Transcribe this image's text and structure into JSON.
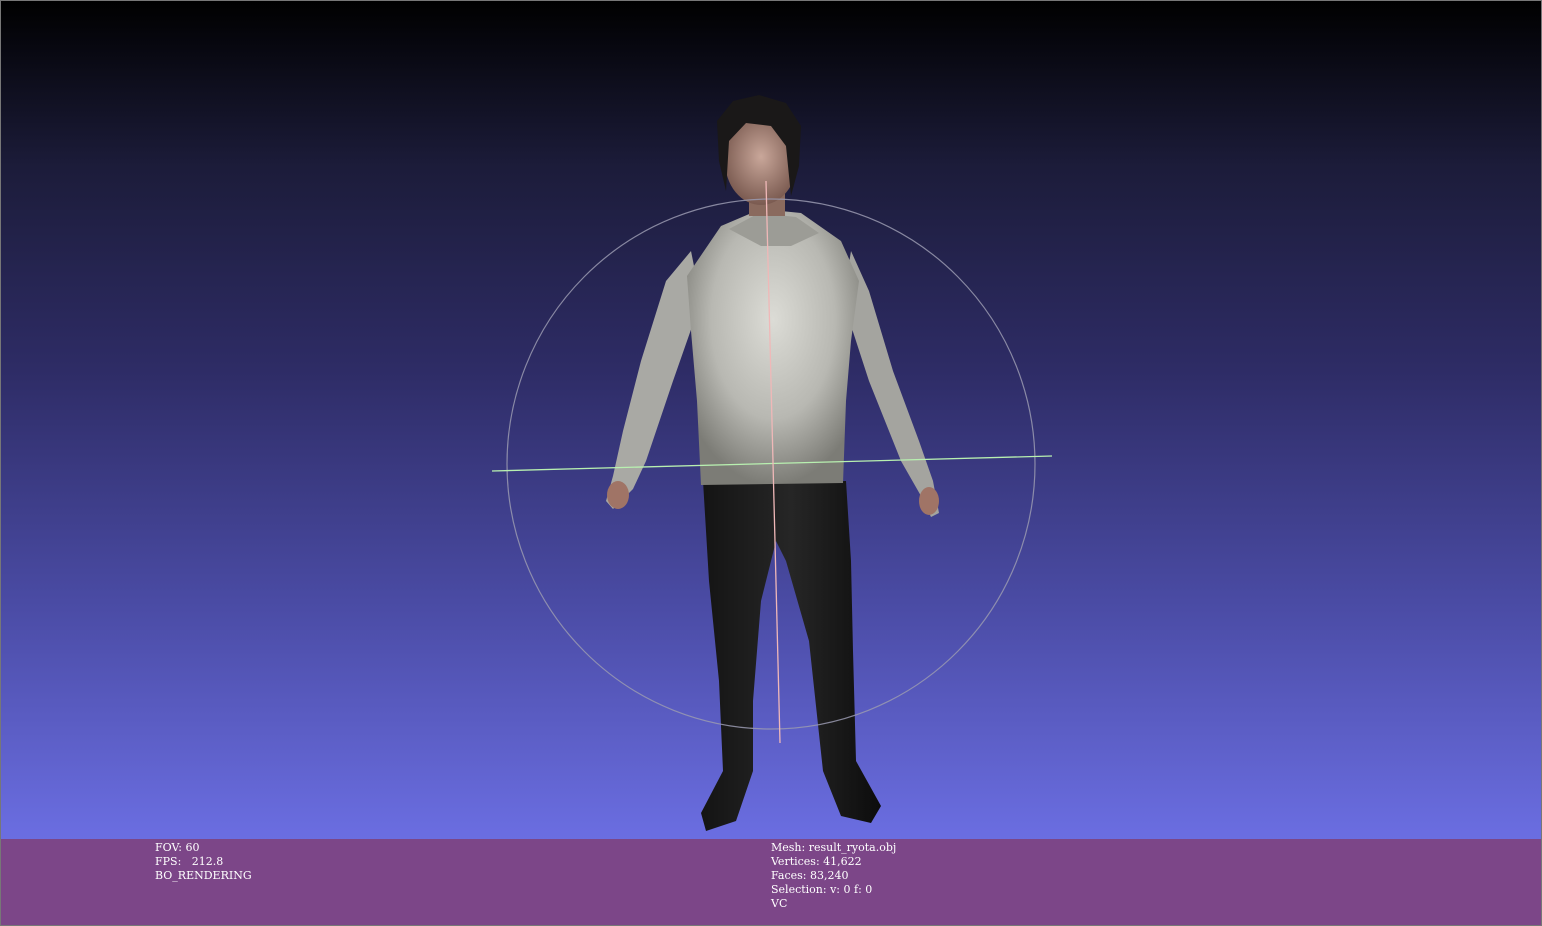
{
  "render_info": {
    "fov": "FOV: 60",
    "fps": "FPS:   212.8",
    "mode": "BO_RENDERING"
  },
  "mesh_info": {
    "mesh": "Mesh: result_ryota.obj",
    "vertices": "Vertices: 41,622",
    "faces": "Faces: 83,240",
    "selection": "Selection: v: 0 f: 0",
    "color_mode": "VC"
  },
  "colors": {
    "background_top": "#000000",
    "background_bottom": "#7275e8",
    "info_bar": "#7c4688",
    "trackball_ring": "#9a9ab0",
    "trackball_axis_horizontal": "#b8f0b0",
    "trackball_axis_vertical": "#f0b8b8"
  }
}
